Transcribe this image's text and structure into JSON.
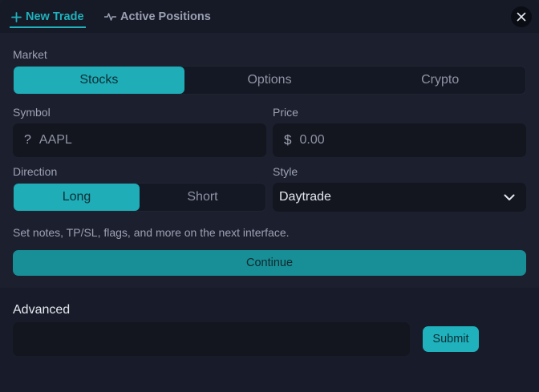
{
  "tabs": {
    "new_trade": "New Trade",
    "active_positions": "Active Positions"
  },
  "icons": {
    "new_trade": "plus-icon",
    "active_positions": "activity-icon",
    "close": "close-icon",
    "style_dropdown": "chevron-down-icon"
  },
  "market": {
    "label": "Market",
    "options": [
      "Stocks",
      "Options",
      "Crypto"
    ],
    "selected": "Stocks"
  },
  "symbol": {
    "label": "Symbol",
    "prefix": "?",
    "value": "AAPL"
  },
  "price": {
    "label": "Price",
    "prefix": "$",
    "placeholder": "0.00"
  },
  "direction": {
    "label": "Direction",
    "options": [
      "Long",
      "Short"
    ],
    "selected": "Long"
  },
  "style": {
    "label": "Style",
    "value": "Daytrade"
  },
  "hint": "Set notes, TP/SL, flags, and more on the next interface.",
  "continue_label": "Continue",
  "advanced": {
    "title": "Advanced",
    "submit_label": "Submit"
  },
  "colors": {
    "accent": "#1fb1bc",
    "background": "#181c2a",
    "field": "#13161f"
  }
}
